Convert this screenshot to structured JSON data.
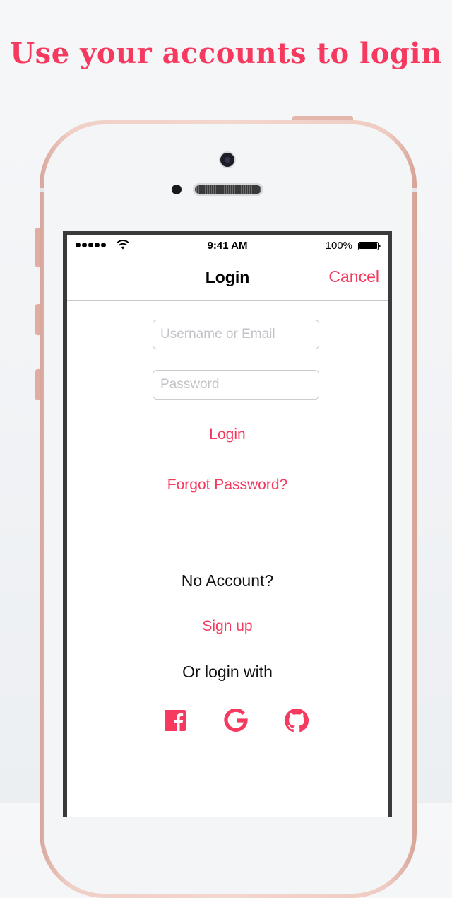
{
  "headline": "Use your accounts to login",
  "status_bar": {
    "time": "9:41 AM",
    "battery": "100%",
    "battery_level": 1.0
  },
  "nav": {
    "title": "Login",
    "cancel_label": "Cancel"
  },
  "form": {
    "username_placeholder": "Username or Email",
    "username_value": "",
    "password_placeholder": "Password",
    "password_value": "",
    "login_label": "Login",
    "forgot_label": "Forgot Password?"
  },
  "signup": {
    "prompt": "No Account?",
    "signup_label": "Sign up",
    "or_login_with": "Or login with"
  },
  "social": [
    {
      "name": "facebook-icon"
    },
    {
      "name": "google-icon"
    },
    {
      "name": "github-icon"
    }
  ],
  "colors": {
    "accent": "#f5395f",
    "phone_frame": "#f0cfc6",
    "background": "#eef0f3"
  }
}
